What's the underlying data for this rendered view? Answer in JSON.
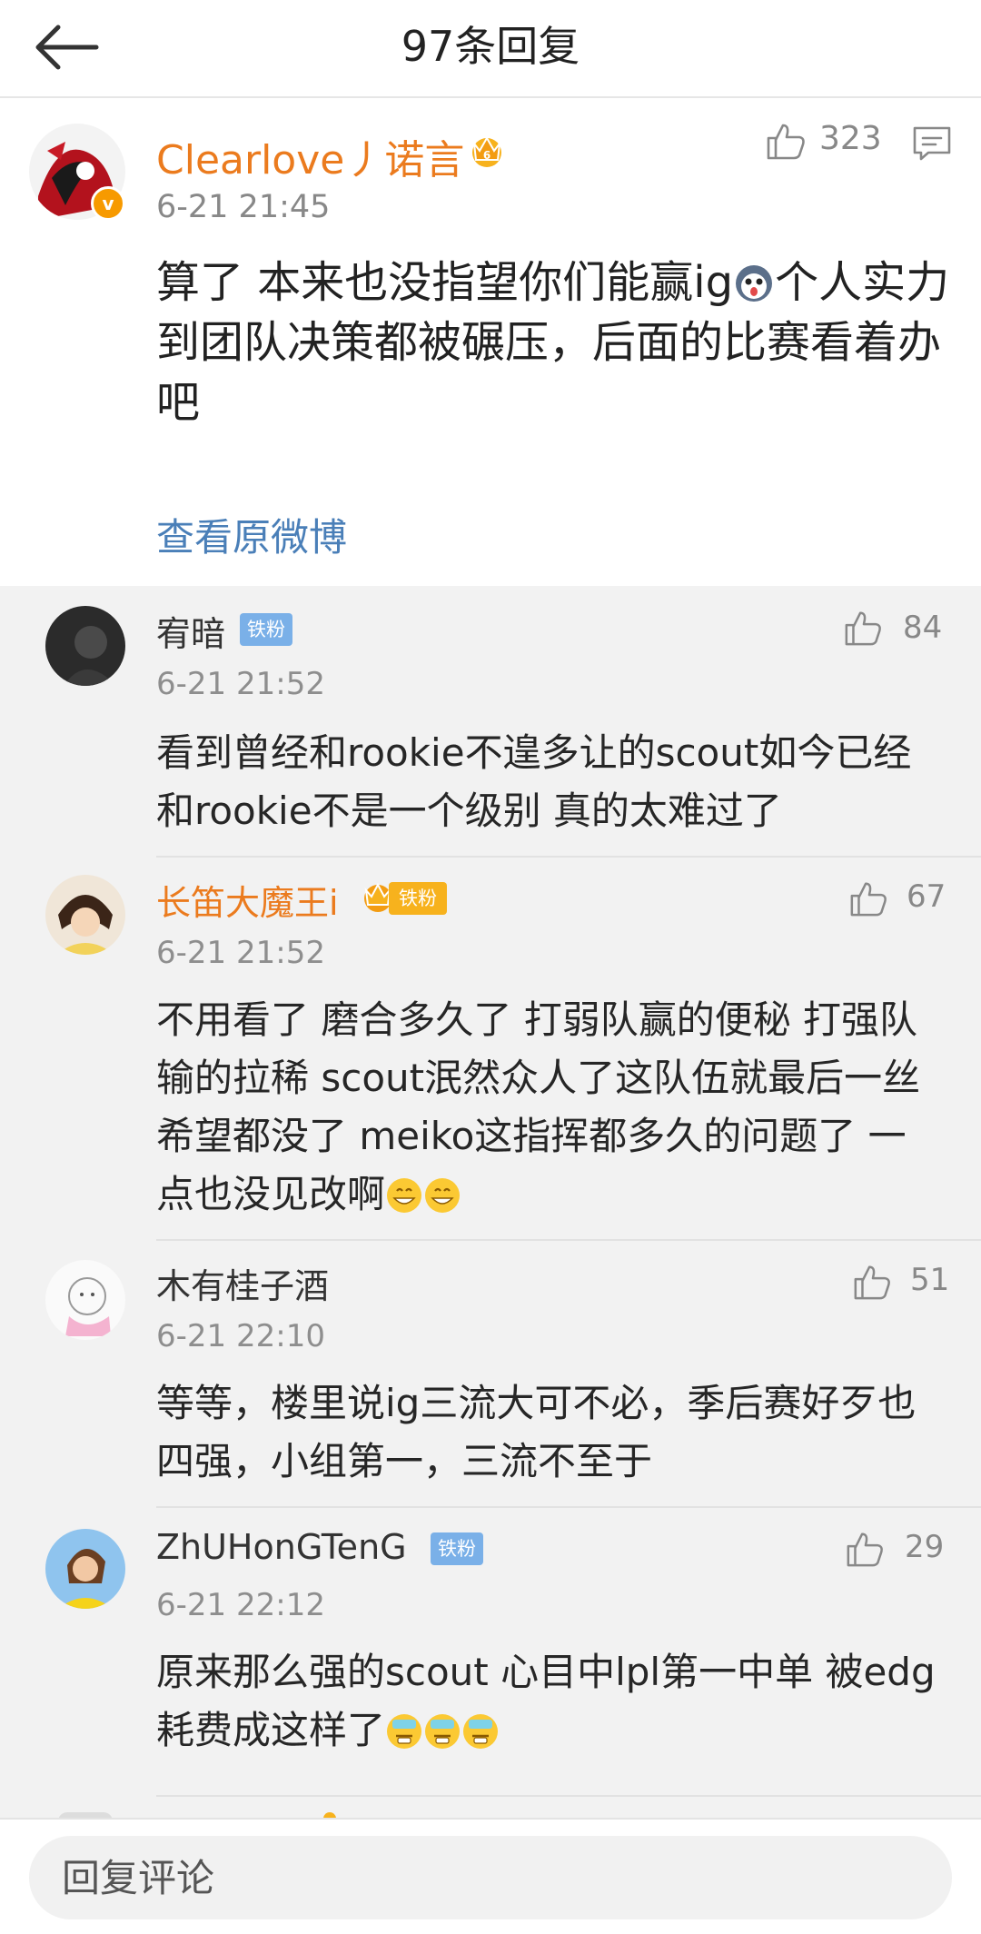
{
  "header": {
    "title": "97条回复"
  },
  "main_comment": {
    "name": "Clearlove丿诺言",
    "time": "6-21 21:45",
    "likes": "323",
    "text_before_emoji": "算了 本来也没指望你们能赢ig",
    "text_after_emoji": "个人实力到团队决策都被碾压，后面的比赛看着办吧",
    "view_original": "查看原微博"
  },
  "replies": [
    {
      "name": "宥暗",
      "badge": "铁粉",
      "time": "6-21 21:52",
      "likes": "84",
      "text": "看到曾经和rookie不遑多让的scout如今已经和rookie不是一个级别 真的太难过了"
    },
    {
      "name": "长笛大魔王i",
      "badge": "铁粉",
      "time": "6-21 21:52",
      "likes": "67",
      "text": "不用看了 磨合多久了 打弱队赢的便秘 打强队输的拉稀 scout泯然众人了这队伍就最后一丝希望都没了 meiko这指挥都多久的问题了 一点也没见改啊"
    },
    {
      "name": "木有桂子酒",
      "time": "6-21 22:10",
      "likes": "51",
      "text": "等等，楼里说ig三流大可不必，季后赛好歹也四强，小组第一，三流不至于"
    },
    {
      "name": "ZhUHonGTenG",
      "badge": "铁粉",
      "time": "6-21 22:12",
      "likes": "29",
      "text": "原来那么强的scout 心目中lpl第一中单 被edg耗费成这样了"
    }
  ],
  "bottom": {
    "placeholder": "回复评论"
  },
  "colors": {
    "vip_name": "#eb7b1e",
    "link": "#4a7fb8",
    "badge_blue": "#7ab0e8",
    "badge_gold": "#f7b21d"
  },
  "icons": [
    "back-arrow-icon",
    "thumbs-up-icon",
    "comment-icon",
    "crown-icon",
    "verified-icon",
    "grinning-emoji-icon",
    "sick-emoji-icon",
    "dog-emoji-icon"
  ]
}
